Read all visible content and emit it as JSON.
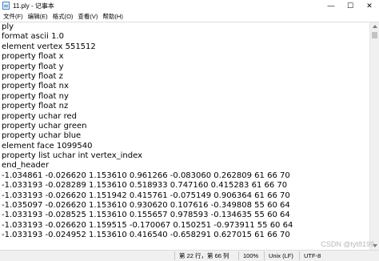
{
  "window": {
    "title": "11.ply - 记事本",
    "minimize": "—",
    "maximize": "☐",
    "close": "✕"
  },
  "menu": [
    "文件(F)",
    "编辑(E)",
    "格式(O)",
    "查看(V)",
    "帮助(H)"
  ],
  "content_lines": [
    "ply",
    "format ascii 1.0",
    "element vertex 551512",
    "property float x",
    "property float y",
    "property float z",
    "property float nx",
    "property float ny",
    "property float nz",
    "property uchar red",
    "property uchar green",
    "property uchar blue",
    "element face 1099540",
    "property list uchar int vertex_index",
    "end_header",
    "-1.034861 -0.026620 1.153610 0.961266 -0.083060 0.262809 61 66 70",
    "-1.033193 -0.028289 1.153610 0.518933 0.747160 0.415283 61 66 70",
    "-1.033193 -0.026620 1.151942 0.415761 -0.075149 0.906364 61 66 70",
    "-1.035097 -0.026620 1.153610 0.930620 0.107616 -0.349808 55 60 64",
    "-1.033193 -0.028525 1.153610 0.155657 0.978593 -0.134635 55 60 64",
    "-1.033193 -0.026620 1.159515 -0.170067 0.150251 -0.973911 55 60 64",
    "-1.033193 -0.024952 1.153610 0.416540 -0.658291 0.627015 61 66 70"
  ],
  "status": {
    "position": "第 22 行，第 66 列",
    "zoom": "100%",
    "line_ending": "Unix (LF)",
    "encoding": "UTF-8"
  },
  "watermark": "CSDN @tyt8199"
}
